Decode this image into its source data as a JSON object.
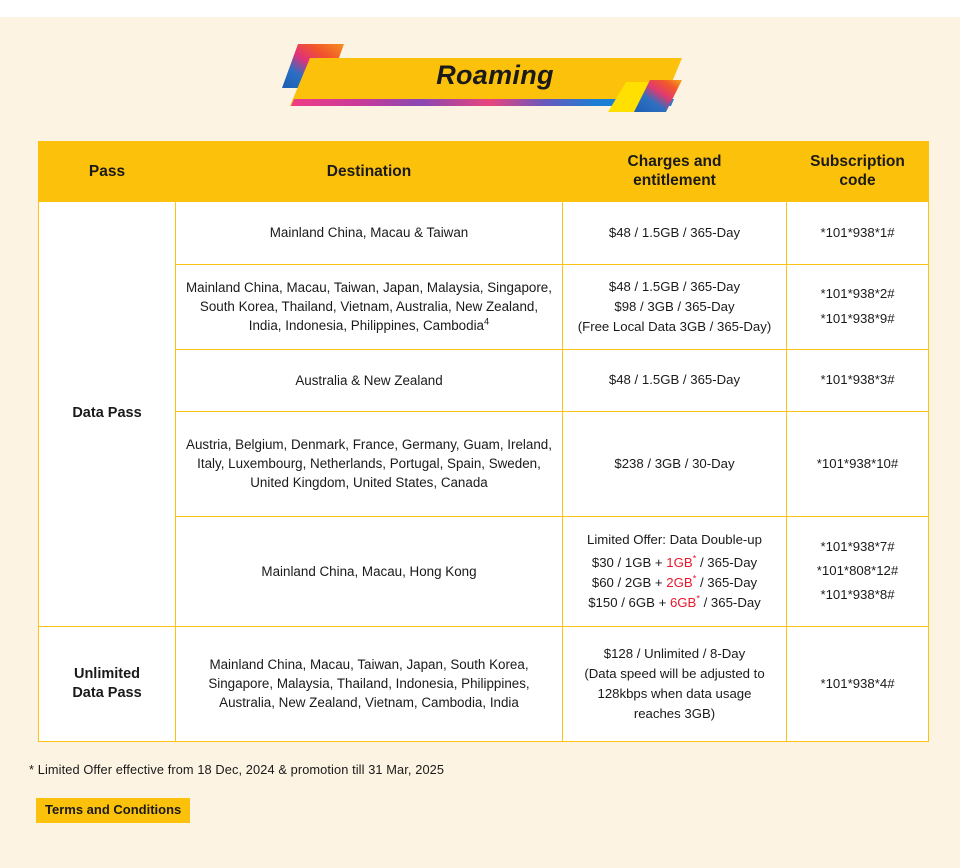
{
  "banner": {
    "title": "Roaming"
  },
  "table": {
    "headers": {
      "pass": "Pass",
      "destination": "Destination",
      "charges": "Charges and entitlement",
      "charges_line1": "Charges and",
      "charges_line2": "entitlement",
      "code_line1": "Subscription",
      "code_line2": "code"
    },
    "pass_groups": {
      "data_pass": "Data Pass",
      "unlimited_line1": "Unlimited",
      "unlimited_line2": "Data Pass"
    },
    "rows": [
      {
        "destination": "Mainland China, Macau & Taiwan",
        "charges": [
          "$48 / 1.5GB / 365-Day"
        ],
        "codes": [
          "*101*938*1#"
        ]
      },
      {
        "destination": "Mainland China, Macau, Taiwan, Japan, Malaysia, Singapore, South Korea, Thailand, Vietnam, Australia, New Zealand, India, Indonesia, Philippines, Cambodia",
        "destination_superscript": "4",
        "charges": [
          "$48 / 1.5GB / 365-Day",
          "$98 / 3GB / 365-Day",
          "(Free Local Data 3GB / 365-Day)"
        ],
        "codes": [
          "*101*938*2#",
          "*101*938*9#"
        ]
      },
      {
        "destination": "Australia & New Zealand",
        "charges": [
          "$48 / 1.5GB / 365-Day"
        ],
        "codes": [
          "*101*938*3#"
        ]
      },
      {
        "destination": "Austria, Belgium, Denmark, France, Germany, Guam, Ireland, Italy, Luxembourg, Netherlands, Portugal, Spain, Sweden, United Kingdom, United States, Canada",
        "charges": [
          "$238 / 3GB / 30-Day"
        ],
        "codes": [
          "*101*938*10#"
        ]
      },
      {
        "destination": "Mainland China, Macau, Hong Kong",
        "offer_title": "Limited Offer: Data Double-up",
        "offer_lines": [
          {
            "prefix": "$30 / 1GB + ",
            "bonus": "1GB",
            "bonus_mark": "*",
            "suffix": " / 365-Day"
          },
          {
            "prefix": "$60 / 2GB + ",
            "bonus": "2GB",
            "bonus_mark": "*",
            "suffix": " / 365-Day"
          },
          {
            "prefix": "$150 / 6GB + ",
            "bonus": "6GB",
            "bonus_mark": "*",
            "suffix": " / 365-Day"
          }
        ],
        "codes": [
          "*101*938*7#",
          "*101*808*12#",
          "*101*938*8#"
        ]
      },
      {
        "destination": "Mainland China, Macau, Taiwan, Japan, South Korea, Singapore, Malaysia, Thailand, Indonesia, Philippines, Australia, New Zealand, Vietnam, Cambodia, India",
        "charges": [
          "$128 / Unlimited / 8-Day",
          "(Data speed will be adjusted to",
          "128kbps when data usage",
          "reaches 3GB)"
        ],
        "codes": [
          "*101*938*4#"
        ]
      }
    ]
  },
  "footnote": "* Limited Offer effective from 18 Dec, 2024 & promotion till 31 Mar, 2025",
  "terms_button": "Terms and Conditions",
  "colors": {
    "background": "#fdf3e3",
    "header_yellow": "#fcc10a",
    "border_yellow": "#fcc314",
    "accent_red": "#e8192c",
    "text": "#1a1a1a"
  }
}
